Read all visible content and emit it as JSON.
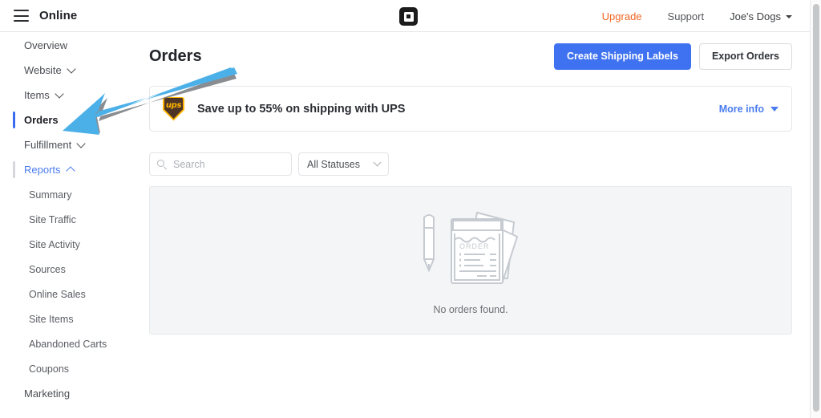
{
  "topbar": {
    "menu_icon": "hamburger-icon",
    "brand": "Online",
    "logo_icon": "square-logo",
    "links": [
      {
        "label": "Upgrade",
        "color": "#f26522"
      },
      {
        "label": "Support",
        "color": "#55575c"
      }
    ],
    "account": {
      "label": "Joe's Dogs",
      "caret_icon": "chevron-down-icon"
    }
  },
  "sidebar": {
    "items": [
      {
        "label": "Overview",
        "type": "item",
        "state": "normal"
      },
      {
        "label": "Website",
        "type": "item",
        "state": "normal",
        "chevron": "chevron-down-icon"
      },
      {
        "label": "Items",
        "type": "item",
        "state": "normal",
        "chevron": "chevron-down-icon"
      },
      {
        "label": "Orders",
        "type": "item",
        "state": "active"
      },
      {
        "label": "Fulfillment",
        "type": "item",
        "state": "normal",
        "chevron": "chevron-down-icon"
      },
      {
        "label": "Reports",
        "type": "item",
        "state": "section-open",
        "chevron": "chevron-up-icon"
      },
      {
        "label": "Summary",
        "type": "sub"
      },
      {
        "label": "Site Traffic",
        "type": "sub"
      },
      {
        "label": "Site Activity",
        "type": "sub"
      },
      {
        "label": "Sources",
        "type": "sub"
      },
      {
        "label": "Online Sales",
        "type": "sub"
      },
      {
        "label": "Site Items",
        "type": "sub"
      },
      {
        "label": "Abandoned Carts",
        "type": "sub"
      },
      {
        "label": "Coupons",
        "type": "sub"
      },
      {
        "label": "Marketing",
        "type": "item",
        "state": "normal"
      }
    ],
    "active_indicator_color": "#3b6bf0",
    "section_indicator_color": "#d5d7da"
  },
  "main": {
    "title": "Orders",
    "primary_button": "Create Shipping Labels",
    "secondary_button": "Export Orders",
    "primary_button_color": "#3f72f0"
  },
  "banner": {
    "logo_icon": "ups-shield-icon",
    "logo_text": "ups",
    "message": "Save up to 55% on shipping with UPS",
    "link": "More info",
    "link_icon": "triangle-down-icon",
    "link_color": "#4a7cf0"
  },
  "filters": {
    "search_placeholder": "Search",
    "search_value": "",
    "search_icon": "search-icon",
    "status_value": "All Statuses",
    "status_icon": "chevron-down-icon",
    "status_options": [
      "All Statuses"
    ]
  },
  "empty_state": {
    "illustration": "orders-receipts-illustration",
    "receipt_label": "ORDER",
    "message": "No orders found."
  },
  "annotation": {
    "arrow_icon": "pointer-arrow-icon",
    "arrow_color": "#4cb0e8",
    "arrow_shadow_color": "#6f7377",
    "points_to": "Orders"
  },
  "scrollbar": {
    "thumb_color": "#c6c7c9"
  }
}
